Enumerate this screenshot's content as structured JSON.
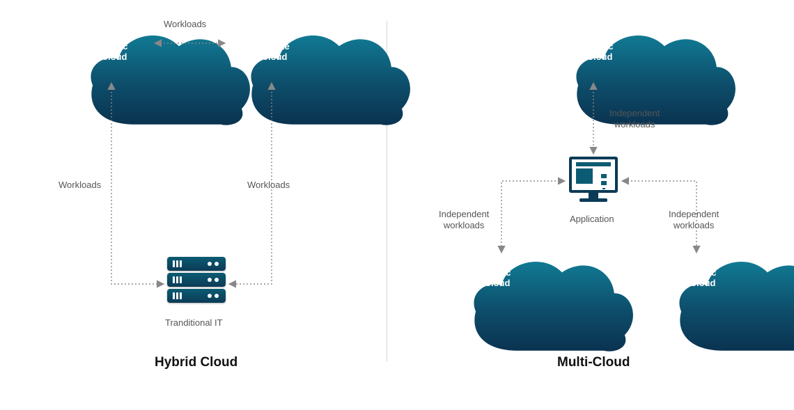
{
  "hybrid": {
    "public_cloud_label": "Public\nCloud",
    "private_cloud_label": "Private\nCloud",
    "top_arrow_label": "Workloads",
    "left_arrow_label": "Workloads",
    "right_arrow_label": "Workloads",
    "rack_label": "Tranditional IT",
    "title": "Hybrid Cloud"
  },
  "multi": {
    "top_cloud_label": "Public\nCloud",
    "left_cloud_label": "Public\nCloud",
    "right_cloud_label": "Public\nCloud",
    "app_label": "Application",
    "top_arrow_label": "Independent\nworkloads",
    "left_arrow_label": "Independent\nworkloads",
    "right_arrow_label": "Independent\nworkloads",
    "title": "Multi-Cloud"
  },
  "colors": {
    "cloud_dark": "#0b3b56",
    "cloud_mid": "#0b5b73",
    "cloud_light": "#0e6f8c",
    "text_muted": "#555"
  }
}
